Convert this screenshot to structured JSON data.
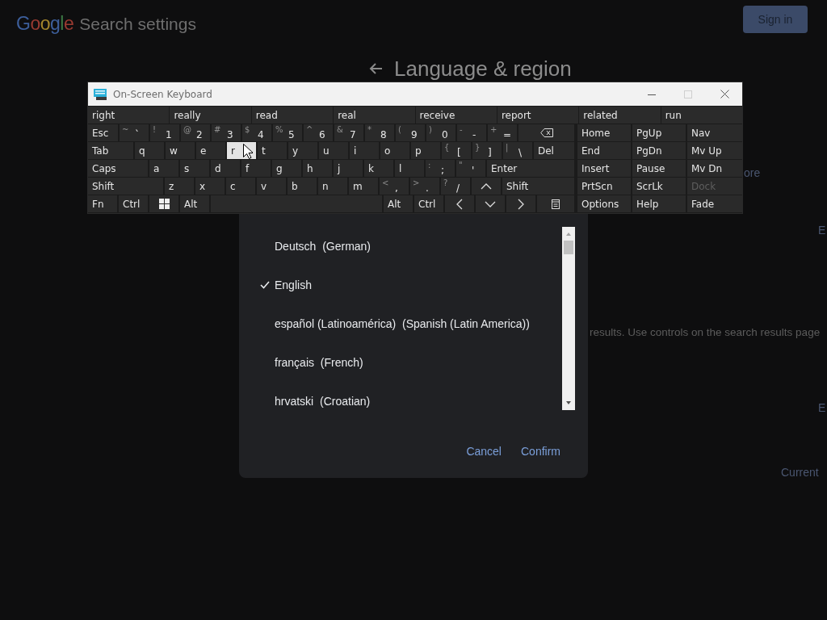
{
  "header": {
    "logo": "Google",
    "title": "Search settings",
    "sign_in": "Sign in"
  },
  "section": {
    "title": "Language & region"
  },
  "background_fragments": [
    {
      "kind": "link",
      "text": "ore"
    },
    {
      "kind": "link",
      "text": "E"
    },
    {
      "kind": "text",
      "text": "results. Use controls on the search results page"
    },
    {
      "kind": "link",
      "text": "E"
    },
    {
      "kind": "link",
      "text": "Current"
    }
  ],
  "keyboard": {
    "title": "On-Screen Keyboard",
    "predictions": [
      "right",
      "really",
      "read",
      "real",
      "receive",
      "report",
      "related",
      "run"
    ],
    "rows": [
      [
        {
          "kind": "key",
          "label": "Esc",
          "highlighted": false
        },
        {
          "kind": "key",
          "shift": "~",
          "label": "`",
          "highlighted": false
        },
        {
          "kind": "key",
          "shift": "!",
          "label": "1",
          "highlighted": false
        },
        {
          "kind": "key",
          "shift": "@",
          "label": "2",
          "highlighted": false
        },
        {
          "kind": "key",
          "shift": "#",
          "label": "3",
          "highlighted": false
        },
        {
          "kind": "key",
          "shift": "$",
          "label": "4",
          "highlighted": false
        },
        {
          "kind": "key",
          "shift": "%",
          "label": "5",
          "highlighted": false
        },
        {
          "kind": "key",
          "shift": "^",
          "label": "6",
          "highlighted": false
        },
        {
          "kind": "key",
          "shift": "&",
          "label": "7",
          "highlighted": false
        },
        {
          "kind": "key",
          "shift": "*",
          "label": "8",
          "highlighted": false
        },
        {
          "kind": "key",
          "shift": "(",
          "label": "9",
          "highlighted": false
        },
        {
          "kind": "key",
          "shift": ")",
          "label": "0",
          "highlighted": false
        },
        {
          "kind": "key",
          "shift": "-",
          "label": "-",
          "highlighted": false
        },
        {
          "kind": "key",
          "shift": "+",
          "label": "=",
          "highlighted": false
        },
        {
          "kind": "backspace",
          "highlighted": false
        }
      ],
      [
        {
          "kind": "key",
          "label": "Tab",
          "highlighted": false
        },
        {
          "kind": "key",
          "label": "q",
          "highlighted": false
        },
        {
          "kind": "key",
          "label": "w",
          "highlighted": false
        },
        {
          "kind": "key",
          "label": "e",
          "highlighted": false
        },
        {
          "kind": "key",
          "label": "r",
          "highlighted": true
        },
        {
          "kind": "key",
          "label": "t",
          "highlighted": false
        },
        {
          "kind": "key",
          "label": "y",
          "highlighted": false
        },
        {
          "kind": "key",
          "label": "u",
          "highlighted": false
        },
        {
          "kind": "key",
          "label": "i",
          "highlighted": false
        },
        {
          "kind": "key",
          "label": "o",
          "highlighted": false
        },
        {
          "kind": "key",
          "label": "p",
          "highlighted": false
        },
        {
          "kind": "key",
          "shift": "{",
          "label": "[",
          "highlighted": false
        },
        {
          "kind": "key",
          "shift": "}",
          "label": "]",
          "highlighted": false
        },
        {
          "kind": "key",
          "shift": "|",
          "label": "\\",
          "highlighted": false
        },
        {
          "kind": "key",
          "label": "Del",
          "highlighted": false
        }
      ],
      [
        {
          "kind": "key",
          "label": "Caps",
          "highlighted": false
        },
        {
          "kind": "key",
          "label": "a",
          "highlighted": false
        },
        {
          "kind": "key",
          "label": "s",
          "highlighted": false
        },
        {
          "kind": "key",
          "label": "d",
          "highlighted": false
        },
        {
          "kind": "key",
          "label": "f",
          "highlighted": false
        },
        {
          "kind": "key",
          "label": "g",
          "highlighted": false
        },
        {
          "kind": "key",
          "label": "h",
          "highlighted": false
        },
        {
          "kind": "key",
          "label": "j",
          "highlighted": false
        },
        {
          "kind": "key",
          "label": "k",
          "highlighted": false
        },
        {
          "kind": "key",
          "label": "l",
          "highlighted": false
        },
        {
          "kind": "key",
          "shift": ":",
          "label": ";",
          "highlighted": false
        },
        {
          "kind": "key",
          "shift": "\"",
          "label": "'",
          "highlighted": false
        },
        {
          "kind": "key",
          "label": "Enter",
          "highlighted": false
        }
      ],
      [
        {
          "kind": "key",
          "label": "Shift",
          "highlighted": false
        },
        {
          "kind": "key",
          "label": "z",
          "highlighted": false
        },
        {
          "kind": "key",
          "label": "x",
          "highlighted": false
        },
        {
          "kind": "key",
          "label": "c",
          "highlighted": false
        },
        {
          "kind": "key",
          "label": "v",
          "highlighted": false
        },
        {
          "kind": "key",
          "label": "b",
          "highlighted": false
        },
        {
          "kind": "key",
          "label": "n",
          "highlighted": false
        },
        {
          "kind": "key",
          "label": "m",
          "highlighted": false
        },
        {
          "kind": "key",
          "shift": "<",
          "label": ",",
          "highlighted": false
        },
        {
          "kind": "key",
          "shift": ">",
          "label": ".",
          "highlighted": false
        },
        {
          "kind": "key",
          "shift": "?",
          "label": "/",
          "highlighted": false
        },
        {
          "kind": "up",
          "highlighted": false
        },
        {
          "kind": "key",
          "label": "Shift",
          "highlighted": false
        }
      ],
      [
        {
          "kind": "key",
          "label": "Fn",
          "highlighted": false
        },
        {
          "kind": "key",
          "label": "Ctrl",
          "highlighted": false
        },
        {
          "kind": "windows",
          "highlighted": false
        },
        {
          "kind": "key",
          "label": "Alt",
          "highlighted": false
        },
        {
          "kind": "space",
          "highlighted": false
        },
        {
          "kind": "key",
          "label": "Alt",
          "highlighted": false
        },
        {
          "kind": "key",
          "label": "Ctrl",
          "highlighted": false
        },
        {
          "kind": "left",
          "highlighted": false
        },
        {
          "kind": "down",
          "highlighted": false
        },
        {
          "kind": "right",
          "highlighted": false
        },
        {
          "kind": "menu",
          "highlighted": false
        }
      ]
    ],
    "nav_keys": [
      {
        "label": "Home",
        "disabled": false
      },
      {
        "label": "PgUp",
        "disabled": false
      },
      {
        "label": "Nav",
        "disabled": false
      },
      {
        "label": "End",
        "disabled": false
      },
      {
        "label": "PgDn",
        "disabled": false
      },
      {
        "label": "Mv Up",
        "disabled": false
      },
      {
        "label": "Insert",
        "disabled": false
      },
      {
        "label": "Pause",
        "disabled": false
      },
      {
        "label": "Mv Dn",
        "disabled": false
      },
      {
        "label": "PrtScn",
        "disabled": false
      },
      {
        "label": "ScrLk",
        "disabled": false
      },
      {
        "label": "Dock",
        "disabled": true
      },
      {
        "label": "Options",
        "disabled": false
      },
      {
        "label": "Help",
        "disabled": false
      },
      {
        "label": "Fade",
        "disabled": false
      }
    ]
  },
  "dialog": {
    "languages": [
      {
        "name": "Deutsch  (German)",
        "selected": false
      },
      {
        "name": "English",
        "selected": true
      },
      {
        "name": "español (Latinoamérica)  (Spanish (Latin America))",
        "selected": false
      },
      {
        "name": "français  (French)",
        "selected": false
      },
      {
        "name": "hrvatski  (Croatian)",
        "selected": false
      }
    ],
    "buttons": [
      "Cancel",
      "Confirm"
    ]
  }
}
